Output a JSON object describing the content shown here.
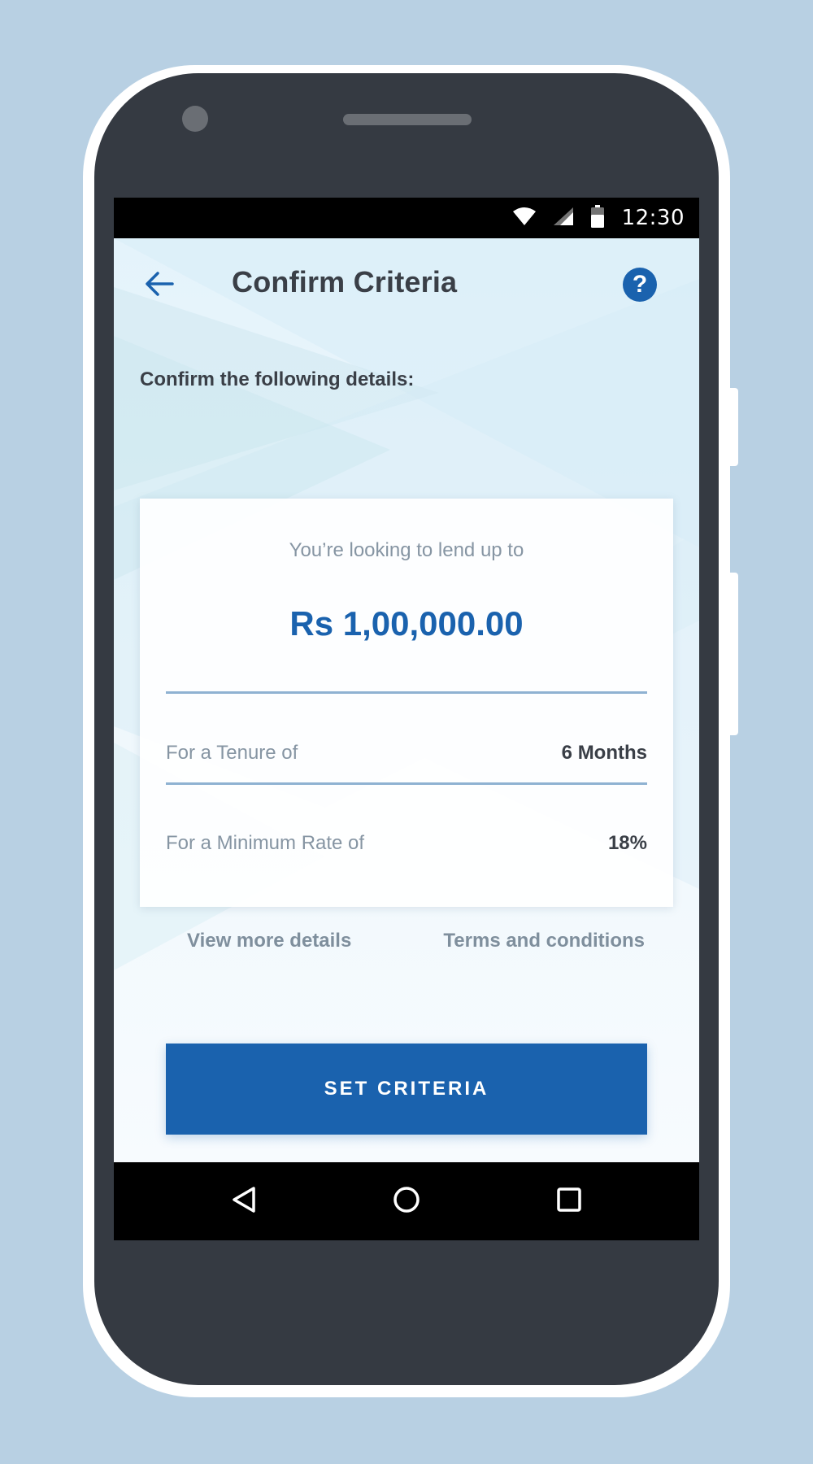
{
  "status_bar": {
    "time": "12:30",
    "icons": [
      "wifi-icon",
      "signal-icon",
      "battery-icon"
    ]
  },
  "header": {
    "back_icon": "arrow-left-icon",
    "title": "Confirm Criteria",
    "help_label": "?"
  },
  "subtitle": "Confirm the following details:",
  "card": {
    "lead": "You’re looking to lend up to",
    "amount": "Rs 1,00,000.00",
    "rows": [
      {
        "label": "For a Tenure of",
        "value": "6 Months"
      },
      {
        "label": "For a Minimum Rate of",
        "value": "18%"
      }
    ]
  },
  "links": {
    "details": "View more details",
    "terms": "Terms and conditions"
  },
  "cta_label": "SET CRITERIA",
  "nav": {
    "icons": [
      "back-triangle-icon",
      "home-circle-icon",
      "recents-square-icon"
    ]
  },
  "colors": {
    "accent": "#1a62ae",
    "page_background": "#b8d0e3",
    "phone_body": "#353a42"
  }
}
